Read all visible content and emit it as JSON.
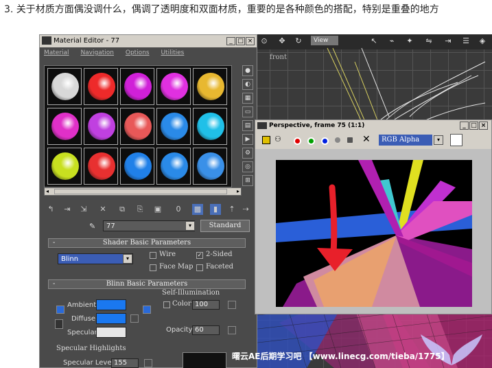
{
  "caption": "3. 关于材质方面偶没调什么，偶调了透明度和双面材质，重要的是各种颜色的搭配，特别是重叠的地方",
  "viewport": {
    "label": "front",
    "tab": "View"
  },
  "material_editor": {
    "title": "Material Editor - 77",
    "menu": [
      "Material",
      "Navigation",
      "Options",
      "Utilities"
    ],
    "slot_colors": [
      "#d8d8d8",
      "#ee2a2a",
      "#d020d8",
      "#e030e0",
      "#e8b830",
      "#e030c8",
      "#c040e0",
      "#e85858",
      "#2a8ae8",
      "#20c0e8",
      "#c8e020",
      "#e83030",
      "#2080e8",
      "#2a8ae8",
      "#3a90e8"
    ],
    "material_name": "77",
    "material_type": "Standard",
    "shader_rollout": "Shader Basic Parameters",
    "shader": "Blinn",
    "options": {
      "wire": "Wire",
      "two_sided": "2-Sided",
      "face_map": "Face Map",
      "faceted": "Faceted"
    },
    "blinn_rollout": "Blinn Basic Parameters",
    "self_illum": {
      "title": "Self-Illumination",
      "color_label": "Color",
      "value": "100"
    },
    "ambient_label": "Ambient",
    "diffuse_label": "Diffuse",
    "specular_label": "Specular",
    "ambient_color": "#1a78f0",
    "diffuse_color": "#1a78f0",
    "specular_color": "#e6e6e6",
    "opacity_label": "Opacity",
    "opacity_value": "60",
    "specular_highlights": {
      "title": "Specular Highlights",
      "level_label": "Specular Level",
      "level_value": "155"
    }
  },
  "render_window": {
    "title": "Perspective, frame 75 (1:1)",
    "channel": "RGB Alpha"
  },
  "watermark": "曙云AE后期学习吧 【www.linecg.com/tieba/1775】"
}
